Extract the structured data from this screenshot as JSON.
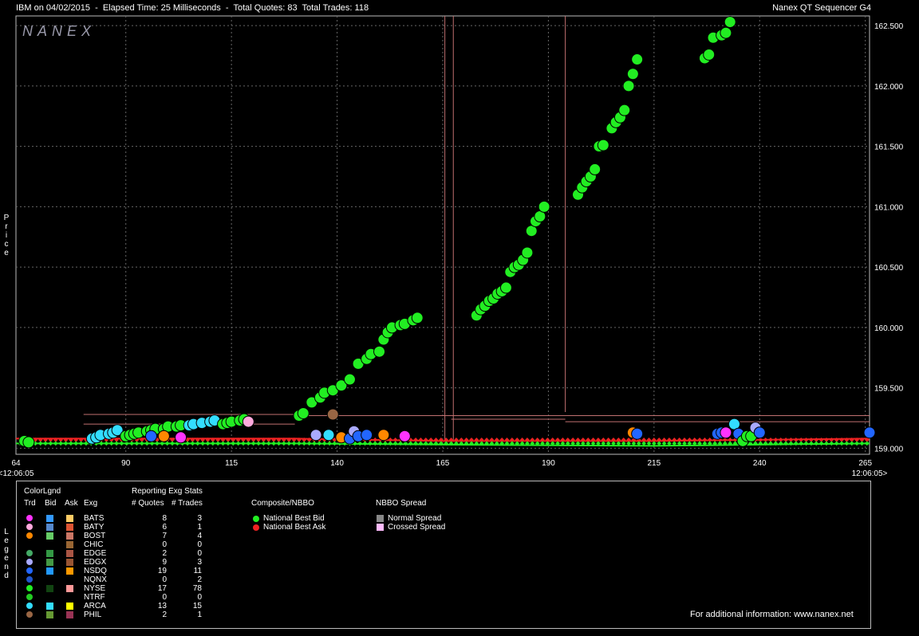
{
  "header": {
    "left": "IBM on 04/02/2015  -  Elapsed Time: 25 Milliseconds  -  Total Quotes: 83  Total Trades: 118",
    "right": "Nanex QT Sequencer G4",
    "brand": "NANEX"
  },
  "axis": {
    "y_title": "Price",
    "x_start_label": "<12:06:05",
    "x_end_label": "12:06:05>"
  },
  "colors": {
    "bid": "#22ee22",
    "ask": "#ee2222",
    "grid": "#666666",
    "spread_line": "#c07070"
  },
  "chart_data": {
    "type": "scatter",
    "xlabel": "",
    "ylabel": "Price",
    "xlim": [
      64,
      266
    ],
    "ylim": [
      158.95,
      162.58
    ],
    "x_ticks": [
      64,
      90,
      115,
      140,
      165,
      190,
      215,
      240,
      265
    ],
    "y_ticks": [
      {
        "v": 159.0,
        "label": "159.000"
      },
      {
        "v": 159.5,
        "label": "159.500"
      },
      {
        "v": 160.0,
        "label": "160.000"
      },
      {
        "v": 160.5,
        "label": "160.500"
      },
      {
        "v": 161.0,
        "label": "161.000"
      },
      {
        "v": 161.5,
        "label": "161.500"
      },
      {
        "v": 162.0,
        "label": "162.000"
      },
      {
        "v": 162.5,
        "label": "162.500"
      }
    ],
    "bid_line": [
      [
        64,
        159.04
      ],
      [
        82,
        159.04
      ],
      [
        130,
        159.04
      ],
      [
        165,
        159.03
      ],
      [
        215,
        159.02
      ],
      [
        266,
        159.04
      ]
    ],
    "ask_line": [
      [
        64,
        159.08
      ],
      [
        130,
        159.08
      ],
      [
        165,
        159.06
      ],
      [
        215,
        159.06
      ],
      [
        266,
        159.08
      ]
    ],
    "trades": [
      {
        "x": 66,
        "y": 159.06,
        "exch": "NYSE"
      },
      {
        "x": 67,
        "y": 159.05,
        "exch": "NYSE"
      },
      {
        "x": 82,
        "y": 159.08,
        "exch": "ARCA"
      },
      {
        "x": 83,
        "y": 159.09,
        "exch": "ARCA"
      },
      {
        "x": 84,
        "y": 159.11,
        "exch": "ARCA"
      },
      {
        "x": 86,
        "y": 159.12,
        "exch": "ARCA"
      },
      {
        "x": 87,
        "y": 159.13,
        "exch": "ARCA"
      },
      {
        "x": 88,
        "y": 159.15,
        "exch": "ARCA"
      },
      {
        "x": 90,
        "y": 159.1,
        "exch": "NYSE"
      },
      {
        "x": 91,
        "y": 159.11,
        "exch": "NYSE"
      },
      {
        "x": 92,
        "y": 159.12,
        "exch": "NYSE"
      },
      {
        "x": 93,
        "y": 159.13,
        "exch": "NYSE"
      },
      {
        "x": 95,
        "y": 159.14,
        "exch": "NYSE"
      },
      {
        "x": 96,
        "y": 159.15,
        "exch": "NYSE"
      },
      {
        "x": 97,
        "y": 159.16,
        "exch": "NYSE"
      },
      {
        "x": 99,
        "y": 159.16,
        "exch": "NYSE"
      },
      {
        "x": 100,
        "y": 159.18,
        "exch": "NYSE"
      },
      {
        "x": 102,
        "y": 159.18,
        "exch": "NYSE"
      },
      {
        "x": 103,
        "y": 159.19,
        "exch": "NYSE"
      },
      {
        "x": 105,
        "y": 159.19,
        "exch": "ARCA"
      },
      {
        "x": 106,
        "y": 159.2,
        "exch": "ARCA"
      },
      {
        "x": 108,
        "y": 159.21,
        "exch": "ARCA"
      },
      {
        "x": 110,
        "y": 159.22,
        "exch": "ARCA"
      },
      {
        "x": 111,
        "y": 159.23,
        "exch": "ARCA"
      },
      {
        "x": 113,
        "y": 159.2,
        "exch": "NYSE"
      },
      {
        "x": 114,
        "y": 159.21,
        "exch": "NYSE"
      },
      {
        "x": 115,
        "y": 159.22,
        "exch": "NYSE"
      },
      {
        "x": 117,
        "y": 159.23,
        "exch": "NYSE"
      },
      {
        "x": 118,
        "y": 159.24,
        "exch": "NYSE"
      },
      {
        "x": 119,
        "y": 159.22,
        "exch": "BATY"
      },
      {
        "x": 96,
        "y": 159.1,
        "exch": "NSDQ"
      },
      {
        "x": 99,
        "y": 159.1,
        "exch": "BOST"
      },
      {
        "x": 103,
        "y": 159.09,
        "exch": "BATS"
      },
      {
        "x": 131,
        "y": 159.27,
        "exch": "NYSE"
      },
      {
        "x": 132,
        "y": 159.29,
        "exch": "NYSE"
      },
      {
        "x": 134,
        "y": 159.38,
        "exch": "NYSE"
      },
      {
        "x": 136,
        "y": 159.42,
        "exch": "NYSE"
      },
      {
        "x": 137,
        "y": 159.46,
        "exch": "NYSE"
      },
      {
        "x": 139,
        "y": 159.48,
        "exch": "NYSE"
      },
      {
        "x": 141,
        "y": 159.52,
        "exch": "NYSE"
      },
      {
        "x": 143,
        "y": 159.57,
        "exch": "NYSE"
      },
      {
        "x": 145,
        "y": 159.7,
        "exch": "NYSE"
      },
      {
        "x": 147,
        "y": 159.74,
        "exch": "NYSE"
      },
      {
        "x": 148,
        "y": 159.78,
        "exch": "NYSE"
      },
      {
        "x": 150,
        "y": 159.8,
        "exch": "NYSE"
      },
      {
        "x": 151,
        "y": 159.9,
        "exch": "NYSE"
      },
      {
        "x": 152,
        "y": 159.96,
        "exch": "NYSE"
      },
      {
        "x": 153,
        "y": 160.0,
        "exch": "NYSE"
      },
      {
        "x": 155,
        "y": 160.02,
        "exch": "NYSE"
      },
      {
        "x": 156,
        "y": 160.03,
        "exch": "NYSE"
      },
      {
        "x": 158,
        "y": 160.06,
        "exch": "NYSE"
      },
      {
        "x": 159,
        "y": 160.08,
        "exch": "NYSE"
      },
      {
        "x": 135,
        "y": 159.11,
        "exch": "EDGX"
      },
      {
        "x": 138,
        "y": 159.11,
        "exch": "ARCA"
      },
      {
        "x": 139,
        "y": 159.28,
        "exch": "PHIL"
      },
      {
        "x": 141,
        "y": 159.09,
        "exch": "BOST"
      },
      {
        "x": 143,
        "y": 159.08,
        "exch": "NSDQ"
      },
      {
        "x": 144,
        "y": 159.14,
        "exch": "EDGX"
      },
      {
        "x": 145,
        "y": 159.1,
        "exch": "NSDQ"
      },
      {
        "x": 147,
        "y": 159.11,
        "exch": "NSDQ"
      },
      {
        "x": 151,
        "y": 159.11,
        "exch": "BOST"
      },
      {
        "x": 156,
        "y": 159.1,
        "exch": "BATS"
      },
      {
        "x": 173,
        "y": 160.1,
        "exch": "NYSE"
      },
      {
        "x": 174,
        "y": 160.15,
        "exch": "NYSE"
      },
      {
        "x": 175,
        "y": 160.18,
        "exch": "NYSE"
      },
      {
        "x": 176,
        "y": 160.22,
        "exch": "NYSE"
      },
      {
        "x": 177,
        "y": 160.24,
        "exch": "NYSE"
      },
      {
        "x": 178,
        "y": 160.28,
        "exch": "NYSE"
      },
      {
        "x": 179,
        "y": 160.3,
        "exch": "NYSE"
      },
      {
        "x": 180,
        "y": 160.33,
        "exch": "NYSE"
      },
      {
        "x": 181,
        "y": 160.46,
        "exch": "NYSE"
      },
      {
        "x": 182,
        "y": 160.5,
        "exch": "NYSE"
      },
      {
        "x": 183,
        "y": 160.52,
        "exch": "NYSE"
      },
      {
        "x": 184,
        "y": 160.56,
        "exch": "NYSE"
      },
      {
        "x": 185,
        "y": 160.62,
        "exch": "NYSE"
      },
      {
        "x": 186,
        "y": 160.8,
        "exch": "NYSE"
      },
      {
        "x": 187,
        "y": 160.88,
        "exch": "NYSE"
      },
      {
        "x": 188,
        "y": 160.92,
        "exch": "NYSE"
      },
      {
        "x": 189,
        "y": 161.0,
        "exch": "NYSE"
      },
      {
        "x": 197,
        "y": 161.1,
        "exch": "NYSE"
      },
      {
        "x": 198,
        "y": 161.16,
        "exch": "NYSE"
      },
      {
        "x": 199,
        "y": 161.21,
        "exch": "NYSE"
      },
      {
        "x": 200,
        "y": 161.25,
        "exch": "NYSE"
      },
      {
        "x": 201,
        "y": 161.31,
        "exch": "NYSE"
      },
      {
        "x": 202,
        "y": 161.5,
        "exch": "NYSE"
      },
      {
        "x": 203,
        "y": 161.51,
        "exch": "NYSE"
      },
      {
        "x": 205,
        "y": 161.65,
        "exch": "NYSE"
      },
      {
        "x": 206,
        "y": 161.7,
        "exch": "NYSE"
      },
      {
        "x": 207,
        "y": 161.74,
        "exch": "NYSE"
      },
      {
        "x": 208,
        "y": 161.8,
        "exch": "NYSE"
      },
      {
        "x": 209,
        "y": 162.0,
        "exch": "NYSE"
      },
      {
        "x": 210,
        "y": 162.1,
        "exch": "NYSE"
      },
      {
        "x": 211,
        "y": 162.22,
        "exch": "NYSE"
      },
      {
        "x": 227,
        "y": 162.23,
        "exch": "NYSE"
      },
      {
        "x": 228,
        "y": 162.26,
        "exch": "NYSE"
      },
      {
        "x": 229,
        "y": 162.4,
        "exch": "NYSE"
      },
      {
        "x": 231,
        "y": 162.42,
        "exch": "NYSE"
      },
      {
        "x": 232,
        "y": 162.44,
        "exch": "NYSE"
      },
      {
        "x": 233,
        "y": 162.53,
        "exch": "NYSE"
      },
      {
        "x": 210,
        "y": 159.13,
        "exch": "BOST"
      },
      {
        "x": 211,
        "y": 159.12,
        "exch": "NSDQ"
      },
      {
        "x": 230,
        "y": 159.12,
        "exch": "NSDQ"
      },
      {
        "x": 231,
        "y": 159.13,
        "exch": "NSDQ"
      },
      {
        "x": 232,
        "y": 159.13,
        "exch": "BATS"
      },
      {
        "x": 234,
        "y": 159.2,
        "exch": "ARCA"
      },
      {
        "x": 235,
        "y": 159.12,
        "exch": "NSDQ"
      },
      {
        "x": 236,
        "y": 159.06,
        "exch": "NYSE"
      },
      {
        "x": 237,
        "y": 159.1,
        "exch": "NYSE"
      },
      {
        "x": 238,
        "y": 159.1,
        "exch": "NYSE"
      },
      {
        "x": 239,
        "y": 159.17,
        "exch": "EDGX"
      },
      {
        "x": 240,
        "y": 159.13,
        "exch": "NSDQ"
      },
      {
        "x": 266,
        "y": 159.13,
        "exch": "NSDQ"
      }
    ]
  },
  "legend": {
    "colorlgnd": "ColorLgnd",
    "col_trd": "Trd",
    "col_bid": "Bid",
    "col_ask": "Ask",
    "col_exg": "Exg",
    "stats_title": "Reporting Exg Stats",
    "col_quotes": "# Quotes",
    "col_trades": "# Trades",
    "composite_title": "Composite/NBBO",
    "nbb": "National Best Bid",
    "nbo": "National Best Ask",
    "spread_title": "NBBO Spread",
    "normal_spread": "Normal Spread",
    "crossed_spread": "Crossed Spread",
    "label_vert": "Legend",
    "footer": "For additional information: www.nanex.net",
    "exchanges": [
      {
        "name": "BATS",
        "trd": "#ff33ff",
        "bid": "#3399ff",
        "ask": "#ffcc66",
        "quotes": "8",
        "trades": "3"
      },
      {
        "name": "BATY",
        "trd": "#ffaadd",
        "bid": "#5588cc",
        "ask": "#dd5533",
        "quotes": "6",
        "trades": "1"
      },
      {
        "name": "BOST",
        "trd": "#ff8800",
        "bid": "#66cc66",
        "ask": "#cc7766",
        "quotes": "7",
        "trades": "4"
      },
      {
        "name": "CHIC",
        "trd": "",
        "bid": "",
        "ask": "#996633",
        "quotes": "0",
        "trades": "0"
      },
      {
        "name": "EDGE",
        "trd": "#44aa66",
        "bid": "#339944",
        "ask": "#aa5544",
        "quotes": "2",
        "trades": "0"
      },
      {
        "name": "EDGX",
        "trd": "#aaaaff",
        "bid": "#449944",
        "ask": "#995533",
        "quotes": "9",
        "trades": "3"
      },
      {
        "name": "NSDQ",
        "trd": "#2266ff",
        "bid": "#2299ff",
        "ask": "#ff9900",
        "quotes": "19",
        "trades": "11"
      },
      {
        "name": "NQNX",
        "trd": "#2255cc",
        "bid": "",
        "ask": "",
        "quotes": "0",
        "trades": "2"
      },
      {
        "name": "NYSE",
        "trd": "#22ee22",
        "bid": "#114411",
        "ask": "#ff9999",
        "quotes": "17",
        "trades": "78"
      },
      {
        "name": "NTRF",
        "trd": "#22cc22",
        "bid": "",
        "ask": "",
        "quotes": "0",
        "trades": "0"
      },
      {
        "name": "ARCA",
        "trd": "#33ddff",
        "bid": "#33ddff",
        "ask": "#ffff00",
        "quotes": "13",
        "trades": "15"
      },
      {
        "name": "PHIL",
        "trd": "#996644",
        "bid": "#669933",
        "ask": "#993355",
        "quotes": "2",
        "trades": "1"
      }
    ]
  }
}
